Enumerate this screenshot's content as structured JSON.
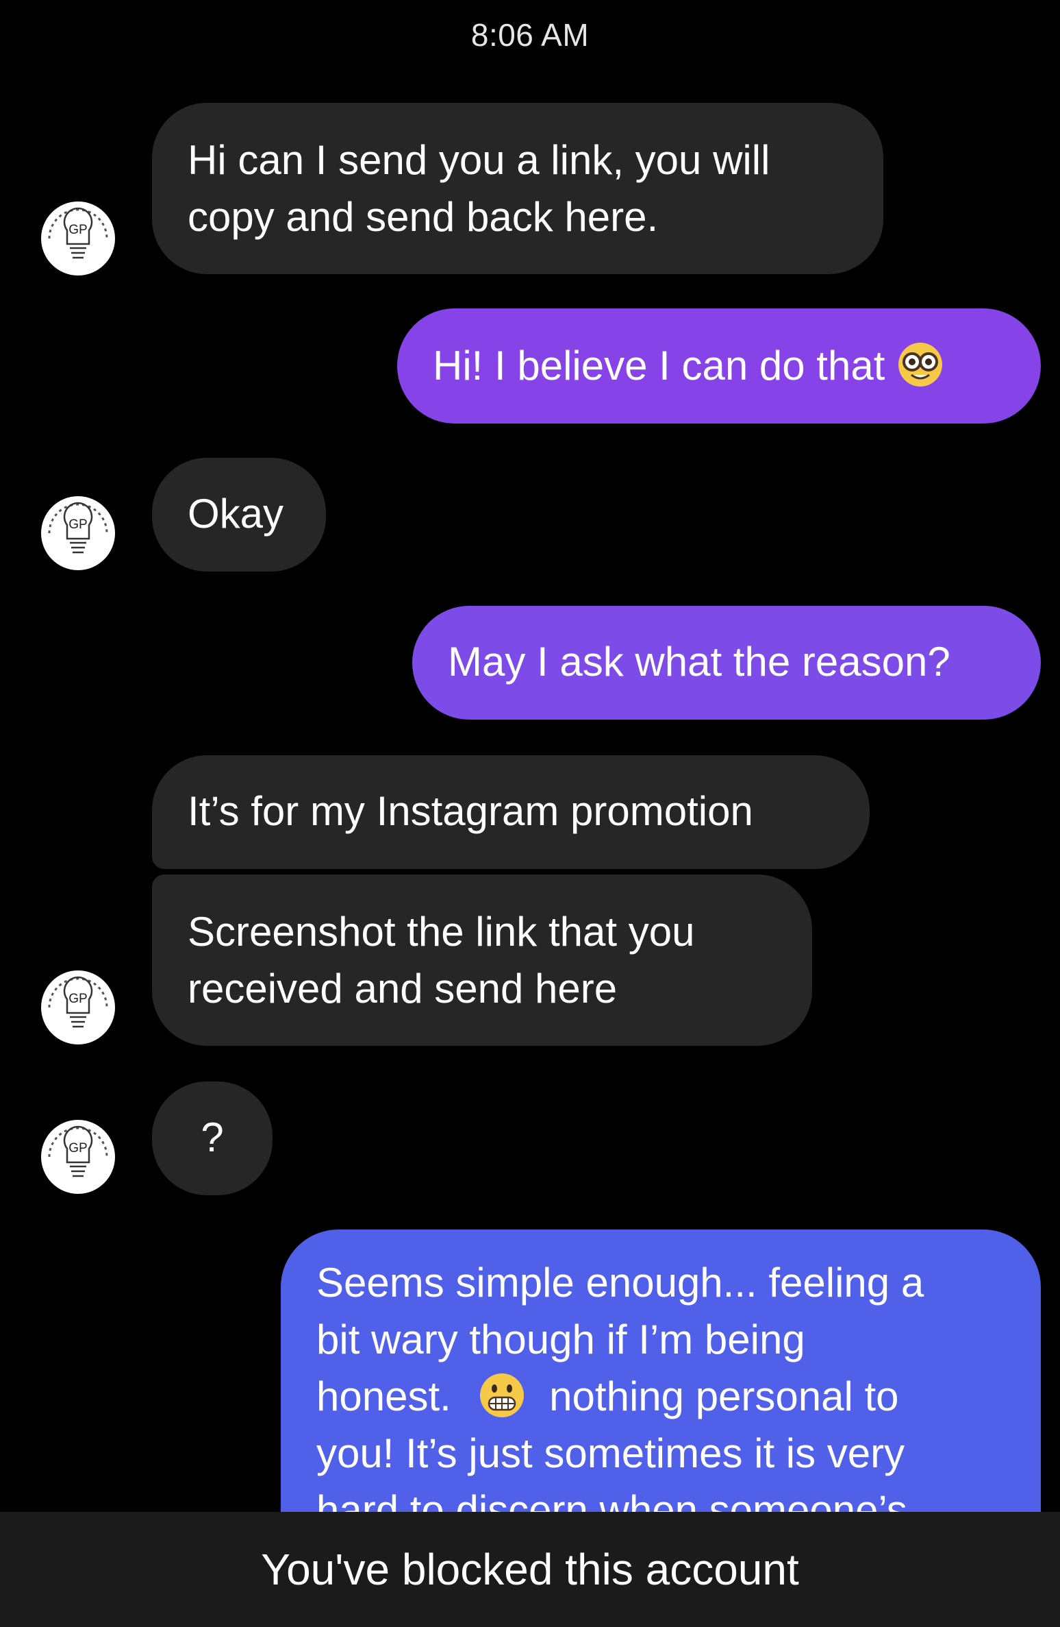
{
  "header": {
    "timestamp": "8:06 AM"
  },
  "contact": {
    "avatar_text": "GP",
    "avatar_icon": "lightbulb-icon"
  },
  "messages": [
    {
      "side": "incoming",
      "lines": [
        "Hi can I send you a link, you will",
        "copy and send back here."
      ]
    },
    {
      "side": "outgoing",
      "lines": [
        "Hi! I believe I can do that"
      ],
      "emoji": "nerd-face-icon"
    },
    {
      "side": "incoming",
      "lines": [
        "Okay"
      ]
    },
    {
      "side": "outgoing",
      "lines": [
        "May I ask what the reason?"
      ]
    },
    {
      "side": "incoming",
      "lines": [
        "It’s for my Instagram promotion"
      ]
    },
    {
      "side": "incoming",
      "lines": [
        "Screenshot the link that you",
        "received and send here"
      ]
    },
    {
      "side": "incoming",
      "lines": [
        "?"
      ]
    },
    {
      "side": "outgoing",
      "lines": [
        "Seems simple enough... feeling a",
        "bit wary though if I’m being",
        "honest.",
        "nothing personal to",
        "you! It’s just sometimes it is very",
        "hard to discern when someone’s"
      ],
      "emoji": "grimacing-face-icon"
    }
  ],
  "footer": {
    "blocked_text": "You've blocked this account"
  },
  "colors": {
    "background": "#000000",
    "incoming_bubble": "#262626",
    "outgoing_top": "#8a45e8",
    "outgoing_bottom": "#4c62e8",
    "blocked_bar": "#1b1b1b"
  }
}
